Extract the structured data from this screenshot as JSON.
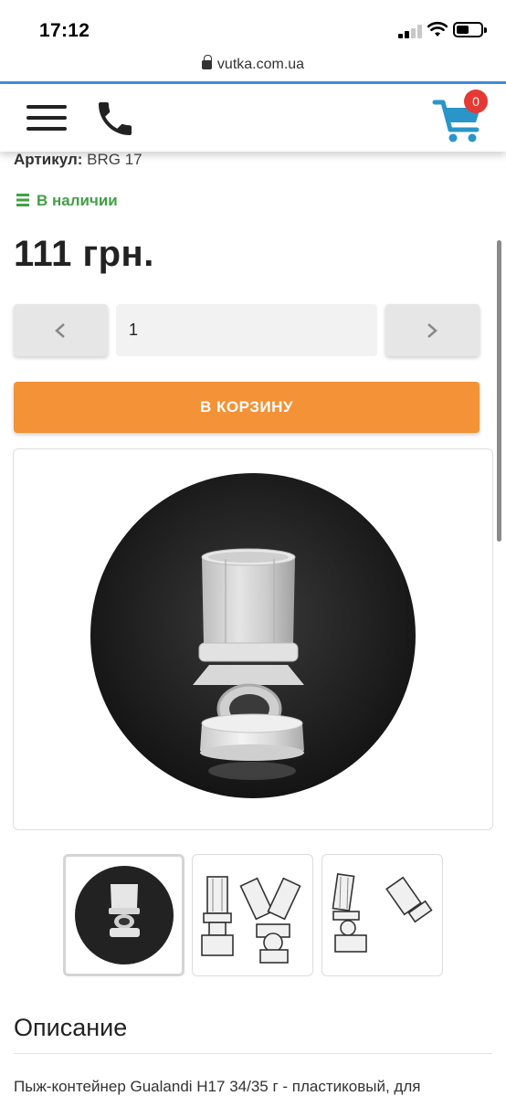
{
  "status_bar": {
    "time": "17:12"
  },
  "browser": {
    "url": "vutka.com.ua"
  },
  "header": {
    "cart_count": "0",
    "colors": {
      "cart": "#2a95c9",
      "badge": "#e53935"
    }
  },
  "product": {
    "sku_label": "Артикул:",
    "sku_value": "BRG 17",
    "stock": "В наличии",
    "price": "111 грн.",
    "quantity": "1",
    "add_to_cart": "В КОРЗИНУ",
    "colors": {
      "accent": "#f39237",
      "in_stock": "#43a047"
    }
  },
  "gallery": {
    "main_image": "wad-container-product-photo",
    "thumbnails": [
      "wad-container-product-photo",
      "wad-container-drawing-front",
      "wad-container-drawing-side"
    ]
  },
  "description": {
    "title": "Описание",
    "text": "Пыж-контейнер Gualandi H17 34/35 г - пластиковый, для"
  }
}
